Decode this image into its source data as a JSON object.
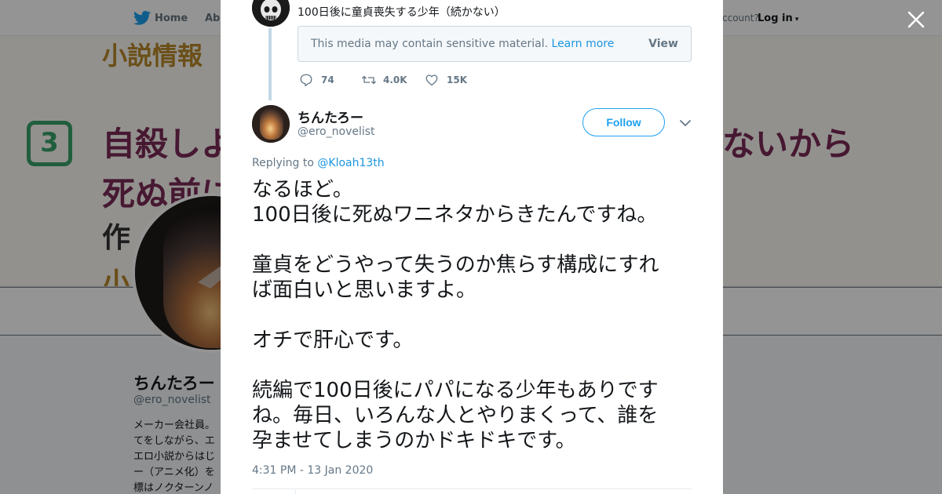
{
  "background": {
    "nav": {
      "home_label": "Home",
      "about_label": "Abo",
      "account_text": "ccount?",
      "login_label": "Log in"
    },
    "banner": {
      "line1": "小説情報",
      "circle_number": "3",
      "line2_left": "自殺しよ",
      "line2_right": "ないから",
      "line3": "死ぬ前に",
      "line4": "作",
      "line5": "小"
    },
    "profile": {
      "name": "ちんたろー",
      "handle": "@ero_novelist",
      "bio_lines": [
        "メーカー会社員。",
        "てをしながら、エ",
        "エロ小説からはじ",
        "ー（アニメ化）を",
        "標はノクターンノ"
      ]
    }
  },
  "modal": {
    "parent_tweet": {
      "text": "100日後に童貞喪失する少年（続かない）",
      "sensitive_notice": "This media may contain sensitive material.",
      "learn_more": "Learn more",
      "view_label": "View",
      "reply_count": "74",
      "retweet_count": "4.0K",
      "like_count": "15K"
    },
    "tweet": {
      "author_name": "ちんたろー",
      "author_handle": "@ero_novelist",
      "follow_label": "Follow",
      "replying_prefix": "Replying to",
      "replying_handle": "@Kloah13th",
      "paragraphs": [
        [
          "なるほど。",
          "100日後に死ぬワニネタからきたんですね。"
        ],
        [
          "童貞をどうやって失うのか焦らす構成にすれ",
          "ば面白いと思いますよ。"
        ],
        [
          "オチで肝心です。"
        ],
        [
          "続編で100日後にパパになる少年もありです",
          "ね。毎日、いろんな人とやりまくって、誰を",
          "孕ませてしまうのかドキドキです。"
        ]
      ],
      "timestamp": "4:31 PM - 13 Jan 2020"
    }
  },
  "colors": {
    "accent": "#1da1f2",
    "link": "#1b95e0",
    "muted": "#657786",
    "text": "#14171a"
  }
}
